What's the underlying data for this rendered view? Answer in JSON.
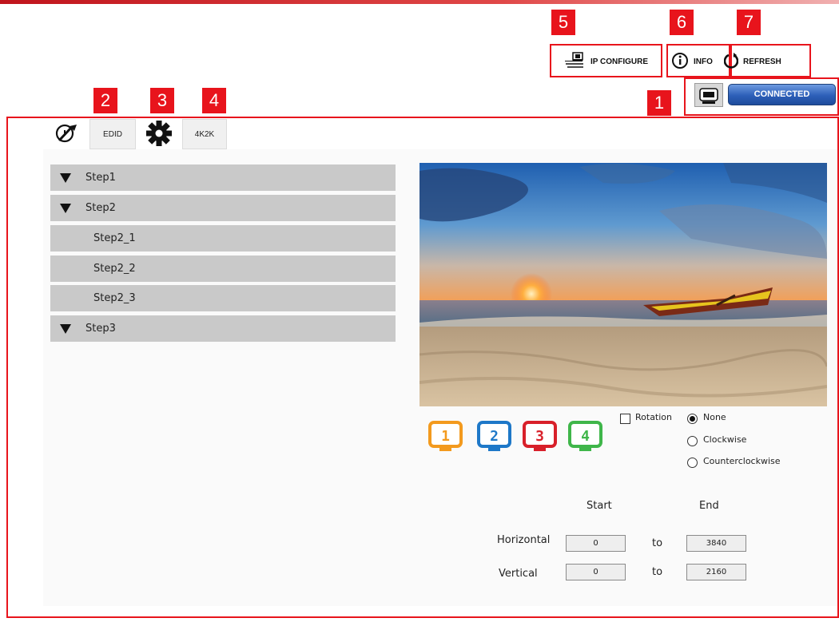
{
  "badges": [
    "5",
    "6",
    "7",
    "2",
    "3",
    "4",
    "1"
  ],
  "toolbar": {
    "ip_configure_label": "IP CONFIGURE",
    "info_label": "INFO",
    "refresh_label": "REFRESH",
    "connected_label": "CONNECTED",
    "device_icon": "usb-device-icon"
  },
  "tabs": [
    {
      "icon": "wrench-icon"
    },
    {
      "label": "EDID"
    },
    {
      "icon": "gear-icon"
    },
    {
      "label": "4K2K"
    }
  ],
  "steps": [
    {
      "label": "Step1",
      "expandable": true
    },
    {
      "label": "Step2",
      "expandable": true
    },
    {
      "label": "Step2_1",
      "expandable": false
    },
    {
      "label": "Step2_2",
      "expandable": false
    },
    {
      "label": "Step2_3",
      "expandable": false
    },
    {
      "label": "Step3",
      "expandable": true
    }
  ],
  "monitors": [
    {
      "number": "1",
      "color": "#f39a1e"
    },
    {
      "number": "2",
      "color": "#1e78c8"
    },
    {
      "number": "3",
      "color": "#d8202a"
    },
    {
      "number": "4",
      "color": "#3fb64a"
    }
  ],
  "rotation": {
    "checkbox_label": "Rotation",
    "checked": false,
    "options": [
      "None",
      "Clockwise",
      "Counterclockwise"
    ],
    "selected": "None"
  },
  "range": {
    "start_header": "Start",
    "end_header": "End",
    "to_label": "to",
    "horizontal": {
      "label": "Horizontal",
      "start": "0",
      "end": "3840"
    },
    "vertical": {
      "label": "Vertical",
      "start": "0",
      "end": "2160"
    }
  },
  "colors": {
    "highlight": "#e8141c",
    "connected": "#2d5fb8",
    "step_bg": "#c9c9c9"
  }
}
